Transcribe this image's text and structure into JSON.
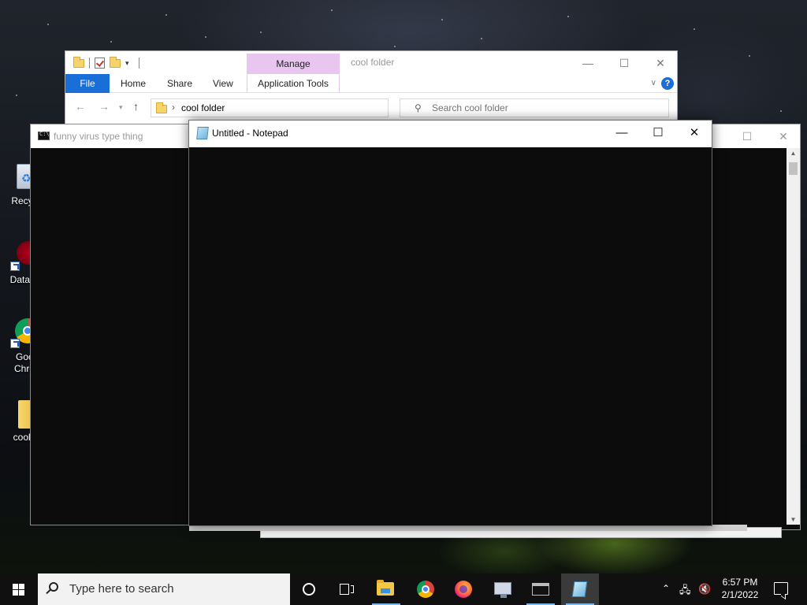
{
  "desktop": {
    "icons": [
      {
        "label": "Recyc",
        "icon": "recycle-bin-icon"
      },
      {
        "label": "DataW",
        "icon": "datawrapper-icon"
      },
      {
        "label": "Goc\nChro",
        "icon": "chrome-icon"
      },
      {
        "label": "cool f",
        "icon": "folder-icon"
      }
    ]
  },
  "explorer": {
    "title": "cool folder",
    "manage_tab": "Manage",
    "ribbon": {
      "file": "File",
      "home": "Home",
      "share": "Share",
      "view": "View",
      "application_tools": "Application Tools",
      "help": "?"
    },
    "address": "cool folder",
    "search_placeholder": "Search cool folder",
    "controls": {
      "minimize": "—",
      "maximize": "☐",
      "close": "✕"
    }
  },
  "console_left": {
    "title": "funny virus type thing"
  },
  "notepad": {
    "title": "Untitled - Notepad",
    "content": "",
    "controls": {
      "minimize": "—",
      "maximize": "☐",
      "close": "✕"
    }
  },
  "taskbar": {
    "search_placeholder": "Type here to search",
    "apps": [
      {
        "name": "file-explorer-icon",
        "running": true,
        "active": false
      },
      {
        "name": "chrome-icon",
        "running": false,
        "active": false
      },
      {
        "name": "firefox-icon",
        "running": false,
        "active": false
      },
      {
        "name": "remote-desktop-icon",
        "running": false,
        "active": false
      },
      {
        "name": "command-prompt-icon",
        "running": true,
        "active": false
      },
      {
        "name": "notepad-icon",
        "running": true,
        "active": true
      }
    ],
    "clock": {
      "time": "6:57 PM",
      "date": "2/1/2022"
    }
  },
  "colors": {
    "accent": "#1a6ed8",
    "manage_tab": "#e8c6f0",
    "console_bg": "#0c0c0c",
    "taskbar_bg": "#101010"
  }
}
